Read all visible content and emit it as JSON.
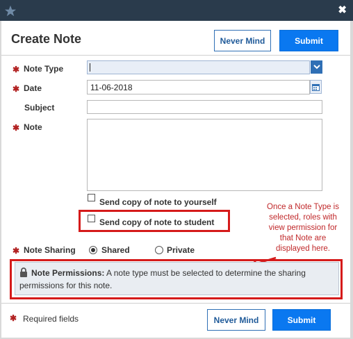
{
  "dialog": {
    "title": "Create Note",
    "close_icon": "close-x-icon",
    "logo_icon": "star-logo-icon",
    "header_buttons": {
      "never_mind": "Never Mind",
      "submit": "Submit"
    },
    "footer_buttons": {
      "never_mind": "Never Mind",
      "submit": "Submit"
    }
  },
  "form": {
    "note_type": {
      "label": "Note Type",
      "value": "",
      "required": true
    },
    "date": {
      "label": "Date",
      "value": "11-06-2018",
      "required": true
    },
    "subject": {
      "label": "Subject",
      "value": ""
    },
    "note": {
      "label": "Note",
      "value": "",
      "required": true
    },
    "copy_self": {
      "label": "Send copy of note to yourself",
      "checked": false
    },
    "copy_student": {
      "label": "Send copy of note to student",
      "checked": false
    },
    "sharing": {
      "label": "Note Sharing",
      "options": [
        "Shared",
        "Private"
      ],
      "selected": "Shared"
    },
    "permissions": {
      "title": "Note Permissions:",
      "text": "A note type must be selected to determine the sharing",
      "text2": "permissions for this note."
    },
    "required_note": "Required fields"
  },
  "annotation": {
    "lines": [
      "Once a Note Type is",
      "selected, roles with",
      "view permission for",
      "that Note are",
      "displayed here."
    ]
  },
  "colors": {
    "accent": "#0a78f0",
    "header_bar": "#2a3b4c",
    "annotation_red": "#d51a1a",
    "required_red": "#b22222"
  }
}
